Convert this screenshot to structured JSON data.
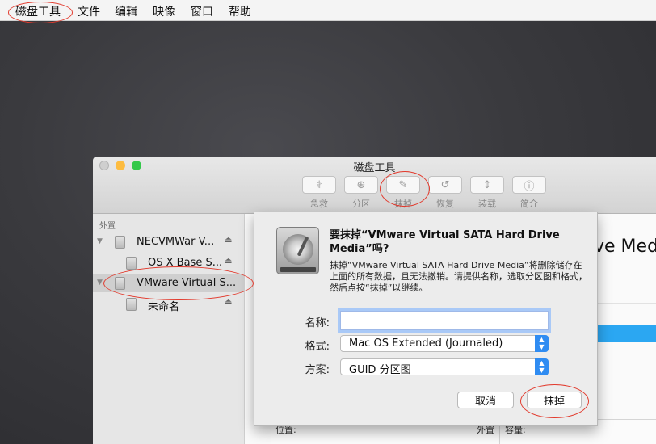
{
  "menubar": {
    "items": [
      {
        "label": "磁盘工具"
      },
      {
        "label": "文件"
      },
      {
        "label": "编辑"
      },
      {
        "label": "映像"
      },
      {
        "label": "窗口"
      },
      {
        "label": "帮助"
      }
    ]
  },
  "window": {
    "title": "磁盘工具",
    "toolbar": [
      {
        "label": "急救",
        "icon": "stethoscope-icon"
      },
      {
        "label": "分区",
        "icon": "partition-icon"
      },
      {
        "label": "抹掉",
        "icon": "erase-icon"
      },
      {
        "label": "恢复",
        "icon": "restore-icon"
      },
      {
        "label": "装载",
        "icon": "mount-icon"
      },
      {
        "label": "简介",
        "icon": "info-icon"
      }
    ],
    "sidebar": {
      "section_header": "外置",
      "items": [
        {
          "label": "NECVMWar V..."
        },
        {
          "label": "OS X Base S..."
        },
        {
          "label": "VMware Virtual S..."
        },
        {
          "label": "未命名"
        }
      ]
    },
    "content": {
      "title_partial": "ve Med",
      "info_labels": {
        "location": "位置:",
        "external": "外置",
        "capacity": "容量:"
      }
    }
  },
  "sheet": {
    "question": "要抹掉“VMware Virtual SATA Hard Drive Media”吗?",
    "description": "抹掉“VMware Virtual SATA Hard Drive Media”将删除储存在上面的所有数据，且无法撤销。请提供名称，选取分区图和格式，然后点按“抹掉”以继续。",
    "name_label": "名称:",
    "name_value": "",
    "format_label": "格式:",
    "format_value": "Mac OS Extended (Journaled)",
    "scheme_label": "方案:",
    "scheme_value": "GUID 分区图",
    "cancel_label": "取消",
    "erase_label": "抹掉"
  },
  "colors": {
    "annotation_red": "#e23b2e",
    "accent_blue": "#2f8cf2",
    "close": "#fc605c",
    "minimize": "#fdbc40",
    "zoom": "#34c84a"
  }
}
